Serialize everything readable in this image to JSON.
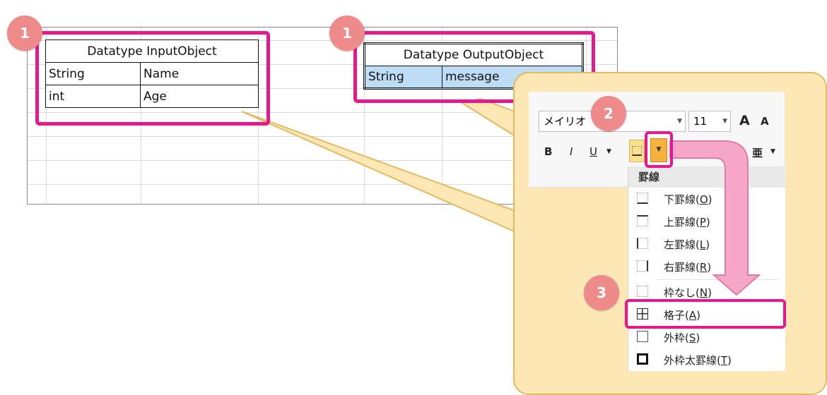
{
  "input_table": {
    "title": "Datatype InputObject",
    "rows": [
      [
        "String",
        "Name"
      ],
      [
        "int",
        "Age"
      ]
    ]
  },
  "output_table": {
    "title": "Datatype OutputObject",
    "rows": [
      [
        "String",
        "message"
      ]
    ]
  },
  "badges": [
    "1",
    "1",
    "2",
    "3"
  ],
  "ribbon": {
    "font_name": "メイリオ",
    "font_size": "11",
    "bold": "B",
    "italic": "I",
    "underline": "U",
    "grow_font": "A",
    "shrink_font": "A",
    "phonetic": "亜"
  },
  "border_menu": {
    "header": "罫線",
    "items": [
      {
        "text": "下罫線(",
        "key": "O",
        "close": ")",
        "icon": "border-bottom-icon"
      },
      {
        "text": "上罫線(",
        "key": "P",
        "close": ")",
        "icon": "border-top-icon"
      },
      {
        "text": "左罫線(",
        "key": "L",
        "close": ")",
        "icon": "border-left-icon"
      },
      {
        "text": "右罫線(",
        "key": "R",
        "close": ")",
        "icon": "border-right-icon"
      },
      {
        "text": "枠なし(",
        "key": "N",
        "close": ")",
        "icon": "no-border-icon"
      },
      {
        "text": "格子(",
        "key": "A",
        "close": ")",
        "icon": "all-borders-icon"
      },
      {
        "text": "外枠(",
        "key": "S",
        "close": ")",
        "icon": "outside-borders-icon"
      },
      {
        "text": "外枠太罫線(",
        "key": "T",
        "close": ")",
        "icon": "thick-box-border-icon"
      }
    ]
  },
  "colors": {
    "highlight": "#e5198b",
    "badge": "#ef8a8a",
    "callout": "#fce7b5",
    "selection": "#bfdcf5",
    "arrow": "#f6a7c8"
  }
}
